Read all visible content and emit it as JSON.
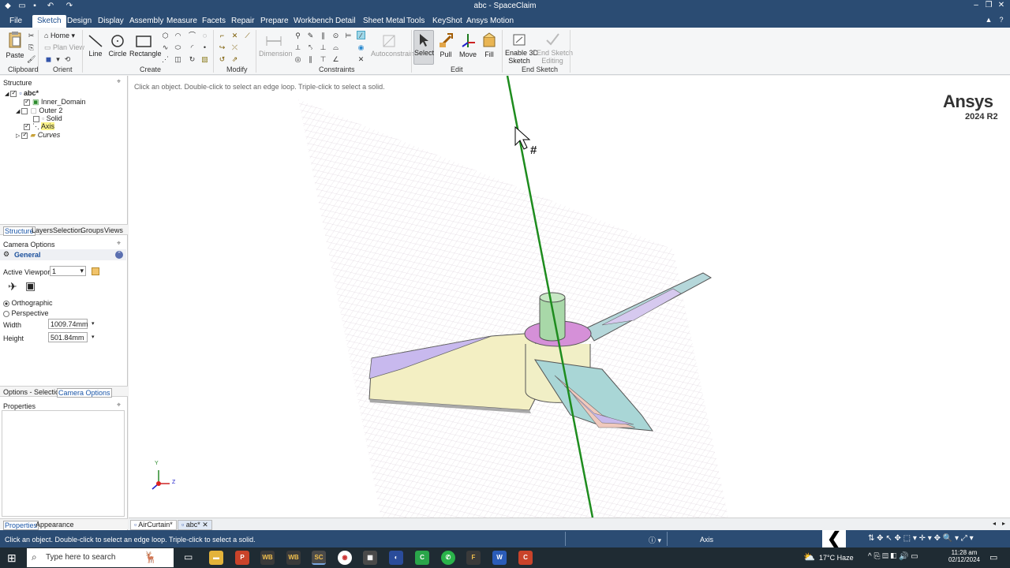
{
  "window": {
    "title": "abc - SpaceClaim"
  },
  "menu": {
    "tabs": [
      "File",
      "Sketch",
      "Design",
      "Display",
      "Assembly",
      "Measure",
      "Facets",
      "Repair",
      "Prepare",
      "Workbench",
      "Detail",
      "Sheet Metal",
      "Tools",
      "KeyShot",
      "Ansys Motion"
    ],
    "active": "Sketch"
  },
  "ribbon": {
    "clipboard": {
      "paste": "Paste",
      "group": "Clipboard"
    },
    "orient": {
      "home": "Home",
      "plan_view": "Plan View",
      "group": "Orient"
    },
    "create": {
      "line": "Line",
      "circle": "Circle",
      "rectangle": "Rectangle",
      "group": "Create"
    },
    "modify": {
      "group": "Modify"
    },
    "constraints": {
      "dimension": "Dimension",
      "autoconstrain": "Autoconstrain",
      "group": "Constraints"
    },
    "edit": {
      "select": "Select",
      "pull": "Pull",
      "move": "Move",
      "fill": "Fill",
      "group": "Edit"
    },
    "end_sketch": {
      "enable_line1": "Enable 3D",
      "enable_line2": "Sketch",
      "end_line1": "End Sketch",
      "end_line2": "Editing",
      "group": "End Sketch"
    }
  },
  "structure": {
    "title": "Structure",
    "tree": [
      {
        "label": "abc*"
      },
      {
        "label": "Inner_Domain"
      },
      {
        "label": "Outer 2"
      },
      {
        "label": "Solid"
      },
      {
        "label": "Axis"
      },
      {
        "label": "Curves"
      }
    ],
    "tabs": [
      "Structure",
      "Layers",
      "Selection",
      "Groups",
      "Views"
    ]
  },
  "options": {
    "title": "Camera Options",
    "section": "General",
    "active_viewport_label": "Active Viewport:",
    "active_viewport_value": "1",
    "orthographic": "Orthographic",
    "perspective": "Perspective",
    "width_label": "Width",
    "width_value": "1009.74mm",
    "height_label": "Height",
    "height_value": "501.84mm",
    "tabs": [
      "Options - Selection",
      "Camera Options"
    ]
  },
  "properties": {
    "title": "Properties",
    "tabs": [
      "Properties",
      "Appearance"
    ]
  },
  "viewport": {
    "hint": "Click an object. Double-click to select an edge loop. Triple-click to select a solid.",
    "brand": "Ansys",
    "version": "2024 R2",
    "axis_x": "Y",
    "axis_z": "Z"
  },
  "doc_tabs": [
    "AirCurtain*",
    "abc*"
  ],
  "status": {
    "message": "Click an object. Double-click to select an edge loop. Triple-click to select a solid.",
    "selection": "Axis"
  },
  "taskbar": {
    "search_placeholder": "Type here to search",
    "weather": "17°C  Haze",
    "time": "11:28 am",
    "date": "02/12/2024"
  },
  "colors": {
    "title_blue": "#2b4c73",
    "axis_green": "#1e8c1e",
    "blade_yellow": "#f2efc2",
    "blade_purple": "#c7b8ec",
    "hub_magenta": "#d48ed6"
  }
}
